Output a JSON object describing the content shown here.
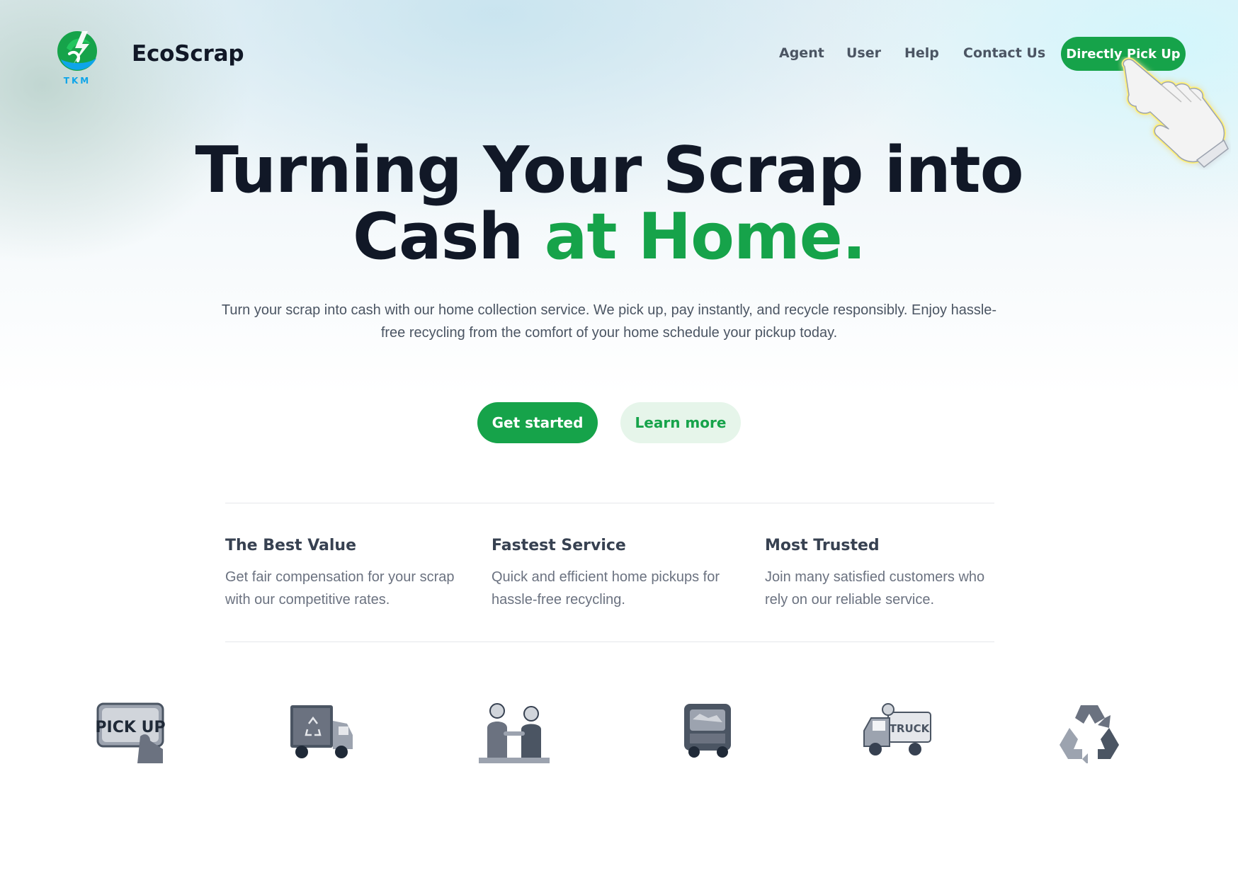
{
  "header": {
    "logo_text": "TKM",
    "brand": "EcoScrap",
    "nav": [
      {
        "label": "Agent"
      },
      {
        "label": "User"
      },
      {
        "label": "Help"
      },
      {
        "label": "Contact Us"
      }
    ],
    "cta_label": "Directly Pick Up"
  },
  "hero": {
    "title_line1": "Turning Your Scrap into",
    "title_line2_dark": "Cash",
    "title_line2_green": "at Home.",
    "subtitle": "Turn your scrap into cash with our home collection service. We pick up, pay instantly, and recycle responsibly. Enjoy hassle-free recycling from the comfort of your home schedule your pickup today.",
    "primary_button": "Get started",
    "secondary_button": "Learn more"
  },
  "features": [
    {
      "title": "The Best Value",
      "text": "Get fair compensation for your scrap with our competitive rates."
    },
    {
      "title": "Fastest Service",
      "text": "Quick and efficient home pickups for hassle-free recycling."
    },
    {
      "title": "Most Trusted",
      "text": "Join many satisfied customers who rely on our reliable service."
    }
  ],
  "icons": [
    {
      "name": "pick-up-sign-icon",
      "label": "PICK UP"
    },
    {
      "name": "recycling-truck-icon"
    },
    {
      "name": "handshake-people-icon"
    },
    {
      "name": "loaded-truck-icon"
    },
    {
      "name": "cartoon-truck-icon",
      "label": "TRUCK"
    },
    {
      "name": "recycle-icon"
    }
  ],
  "colors": {
    "accent": "#16a34a",
    "accent_light": "#e6f5ea",
    "heading": "#111827",
    "body_text": "#4b5563",
    "muted": "#6b7280"
  }
}
